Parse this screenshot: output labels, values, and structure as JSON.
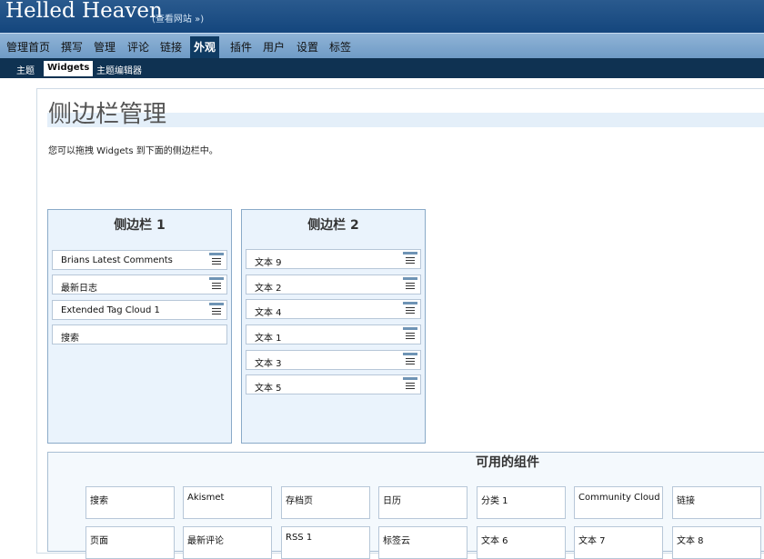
{
  "header": {
    "site_title": "Helled Heaven",
    "view_site": "(查看网站 »)"
  },
  "menu": {
    "items": [
      "管理首页",
      "撰写",
      "管理",
      "评论",
      "链接",
      "外观",
      "插件",
      "用户",
      "设置",
      "标签"
    ],
    "active": "外观"
  },
  "submenu": {
    "items": [
      "主题",
      "Widgets",
      "主题编辑器"
    ],
    "active": "Widgets"
  },
  "page": {
    "title": "侧边栏管理",
    "instructions": "您可以拖拽 Widgets 到下面的侧边栏中。"
  },
  "sidebars": [
    {
      "title": "侧边栏 1",
      "widgets": [
        {
          "label": "Brians Latest Comments",
          "handle": true
        },
        {
          "label": "最新日志",
          "handle": true
        },
        {
          "label": "Extended Tag Cloud 1",
          "handle": true
        },
        {
          "label": "搜索",
          "handle": false
        }
      ]
    },
    {
      "title": "侧边栏 2",
      "widgets": [
        {
          "label": "文本 9",
          "handle": true
        },
        {
          "label": "文本 2",
          "handle": true
        },
        {
          "label": "文本 4",
          "handle": true
        },
        {
          "label": "文本 1",
          "handle": true
        },
        {
          "label": "文本 3",
          "handle": true
        },
        {
          "label": "文本 5",
          "handle": true
        }
      ]
    }
  ],
  "available": {
    "title": "可用的组件",
    "widgets": [
      [
        "搜索",
        "Akismet",
        "存档页",
        "日历",
        "分类 1",
        "Community Cloud",
        "链接"
      ],
      [
        "页面",
        "最新评论",
        "RSS 1",
        "标签云",
        "文本 6",
        "文本 7",
        "文本 8"
      ]
    ]
  },
  "colors": {
    "header": "#14467d",
    "menu": "#7fa6cc",
    "submenu": "#0f3252",
    "panel_bg": "#eaf3fc",
    "panel_border": "#8aaac8"
  }
}
